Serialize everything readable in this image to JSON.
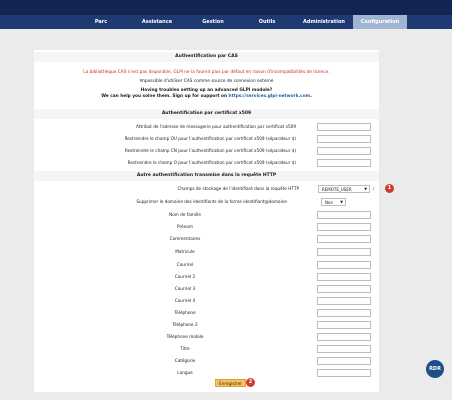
{
  "menu": {
    "items": [
      {
        "label": "Parc"
      },
      {
        "label": "Assistance"
      },
      {
        "label": "Gestion"
      },
      {
        "label": "Outils"
      },
      {
        "label": "Administration"
      },
      {
        "label": "Configuration"
      }
    ],
    "active": "Configuration"
  },
  "cas": {
    "title": "Authentification par CAS",
    "error": "La bibliothèque CAS n'est pas disponible, GLPI ne la fournit plus par défaut en raison d'incompatibilités de licence.",
    "impossible": "Impossible d'utiliser CAS comme source de connexion externe",
    "help_line1": "Having troubles setting up an advanced GLPI module?",
    "help_line2_prefix": "We can help you solve them. Sign up for support on ",
    "help_link": "https://services.glpi-network.com",
    "help_line2_suffix": "."
  },
  "x509": {
    "title": "Authentification par certificat x509",
    "rows": [
      {
        "label": "Attribut de l'adresse de messagerie pour authentification par certificat x509",
        "value": ""
      },
      {
        "label": "Restreindre le champ OU pour l'authentification par certificat x509 (séparateur $)",
        "value": ""
      },
      {
        "label": "Restreindre le champ CN pour l'authentification par certificat x509 (séparateur $)",
        "value": ""
      },
      {
        "label": "Restreindre le champ O pour l'authentification par certificat x509 (séparateur $)",
        "value": ""
      }
    ]
  },
  "http": {
    "title": "Autre authentification transmise dans la requête HTTP",
    "storage_label": "Champs de stockage de l'identifiant dans la requête HTTP",
    "storage_value": "REMOTE_USER",
    "storage_info": "i",
    "strip_label": "Supprimer le domaine des identifiants de la forme identifiant@domaine",
    "strip_value": "Non",
    "fields": [
      {
        "label": "Nom de famille",
        "value": ""
      },
      {
        "label": "Prénom",
        "value": ""
      },
      {
        "label": "Commentaires",
        "value": ""
      },
      {
        "label": "Matricule",
        "value": ""
      },
      {
        "label": "Courriel",
        "value": ""
      },
      {
        "label": "Courriel 2",
        "value": ""
      },
      {
        "label": "Courriel 3",
        "value": ""
      },
      {
        "label": "Courriel 4",
        "value": ""
      },
      {
        "label": "Téléphone",
        "value": ""
      },
      {
        "label": "Téléphone 2",
        "value": ""
      },
      {
        "label": "Téléphone mobile",
        "value": ""
      },
      {
        "label": "Titre",
        "value": ""
      },
      {
        "label": "Catégorie",
        "value": ""
      },
      {
        "label": "Langue",
        "value": ""
      }
    ]
  },
  "save_label": "Enregistrer",
  "badges": {
    "one": "1",
    "two": "2"
  },
  "rdr_logo": "RDR"
}
